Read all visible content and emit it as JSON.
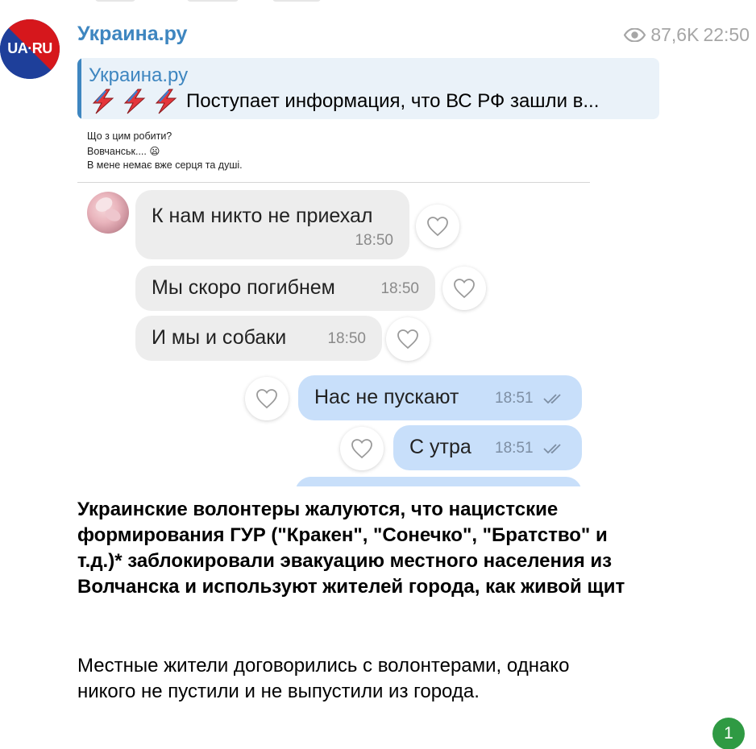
{
  "channel": {
    "name": "Украина.ру",
    "avatar_text": "UA·RU",
    "views": "87,6K",
    "time": "22:50"
  },
  "reply": {
    "name": "Украина.ру",
    "text": "Поступает информация, что ВС РФ зашли в..."
  },
  "image": {
    "caption": [
      "Що з цим робити?",
      "Вовчанськ.... 😦",
      "В мене немає вже серця та душі."
    ],
    "messages": [
      {
        "text": "К нам никто не приехал",
        "time": "18:50",
        "direction": "in"
      },
      {
        "text": "Мы скоро погибнем",
        "time": "18:50",
        "direction": "in"
      },
      {
        "text": "И мы и собаки",
        "time": "18:50",
        "direction": "in"
      },
      {
        "text": "Нас не пускают",
        "time": "18:51",
        "direction": "out"
      },
      {
        "text": "С утра",
        "time": "18:51",
        "direction": "out"
      }
    ]
  },
  "post": {
    "bold_text": "Украинские волонтеры жалуются, что нацистские формирования ГУР (\"Кракен\", \"Сонечко\", \"Братство\" и т.д.)* заблокировали эвакуацию местного населения из Волчанска и используют жителей города, как живой щит",
    "text": "Местные жители договорились с волонтерами, однако никого не пустили и не выпустили из города."
  },
  "unread_count": "1",
  "colors": {
    "accent": "#3e86c0",
    "reply_bg": "#eaf2f9",
    "incoming_bubble": "#ededed",
    "outgoing_bubble": "#c8dffa",
    "badge": "#2f9a43"
  }
}
